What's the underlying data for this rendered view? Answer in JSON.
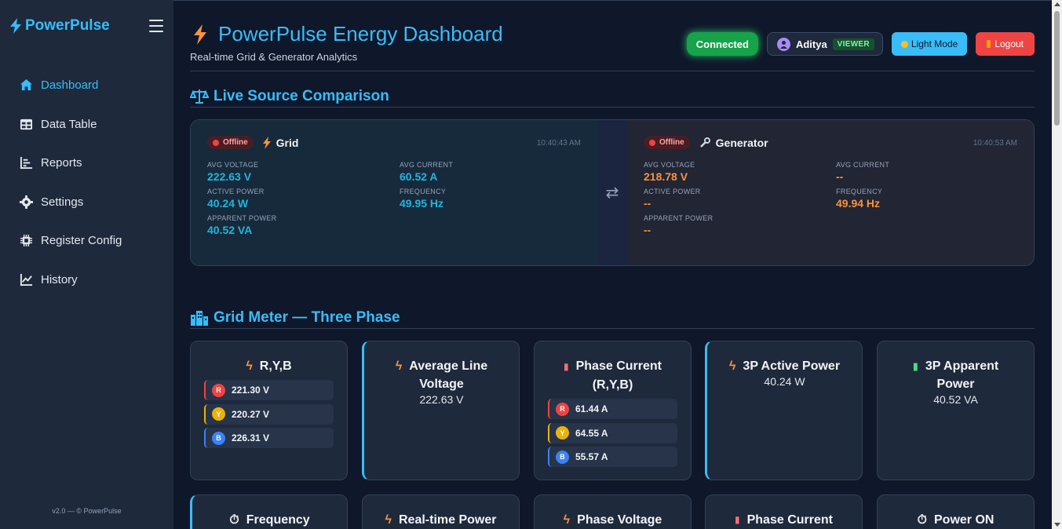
{
  "sidebar": {
    "brand": "PowerPulse",
    "items": [
      {
        "label": "Dashboard",
        "icon": "home-icon"
      },
      {
        "label": "Data Table",
        "icon": "table-icon"
      },
      {
        "label": "Reports",
        "icon": "chart-bars-icon"
      },
      {
        "label": "Settings",
        "icon": "gear-icon"
      },
      {
        "label": "Register Config",
        "icon": "chip-icon"
      },
      {
        "label": "History",
        "icon": "line-chart-icon"
      }
    ],
    "active_index": 0,
    "version": "v2.0 — © PowerPulse"
  },
  "header": {
    "title": "PowerPulse Energy Dashboard",
    "subtitle": "Real-time Grid & Generator Analytics",
    "status": "Connected",
    "user": "Aditya",
    "role": "VIEWER",
    "light_mode": "Light Mode",
    "logout": "Logout"
  },
  "comparison": {
    "title": "Live Source Comparison",
    "grid": {
      "status": "Offline",
      "name": "Grid",
      "time": "10:40:43 AM",
      "avg_voltage_label": "AVG VOLTAGE",
      "avg_voltage": "222.63 V",
      "avg_current_label": "AVG CURRENT",
      "avg_current": "60.52 A",
      "active_power_label": "ACTIVE POWER",
      "active_power": "40.24 W",
      "frequency_label": "FREQUENCY",
      "frequency": "49.95 Hz",
      "apparent_power_label": "APPARENT POWER",
      "apparent_power": "40.52 VA"
    },
    "generator": {
      "status": "Offline",
      "name": "Generator",
      "time": "10:40:53 AM",
      "avg_voltage_label": "AVG VOLTAGE",
      "avg_voltage": "218.78 V",
      "avg_current_label": "AVG CURRENT",
      "avg_current": "--",
      "active_power_label": "ACTIVE POWER",
      "active_power": "--",
      "frequency_label": "FREQUENCY",
      "frequency": "49.94 Hz",
      "apparent_power_label": "APPARENT POWER",
      "apparent_power": "--"
    }
  },
  "grid_meter": {
    "title": "Grid Meter — Three Phase",
    "cards": {
      "ryb": {
        "title": "R,Y,B",
        "r": "221.30 V",
        "y": "220.27 V",
        "b": "226.31 V"
      },
      "avg_line_voltage": {
        "title_1": "Average Line",
        "title_2": "Voltage",
        "value": "222.63 V"
      },
      "phase_current": {
        "title_1": "Phase Current",
        "title_2": "(R,Y,B)",
        "r": "61.44 A",
        "y": "64.55 A",
        "b": "55.57 A"
      },
      "active_power_3p": {
        "title": "3P Active Power",
        "value": "40.24 W"
      },
      "apparent_power_3p": {
        "title_1": "3P Apparent",
        "title_2": "Power",
        "value": "40.52 VA"
      }
    },
    "row2": [
      "Frequency",
      "Real-time Power",
      "Phase Voltage",
      "Phase Current",
      "Power ON"
    ],
    "phase_letters": {
      "r": "R",
      "y": "Y",
      "b": "B"
    }
  },
  "colors": {
    "accent": "#38bdf8",
    "grid_value": "#22b5dc",
    "gen_value": "#fb923c",
    "offline": "#ef4444"
  }
}
